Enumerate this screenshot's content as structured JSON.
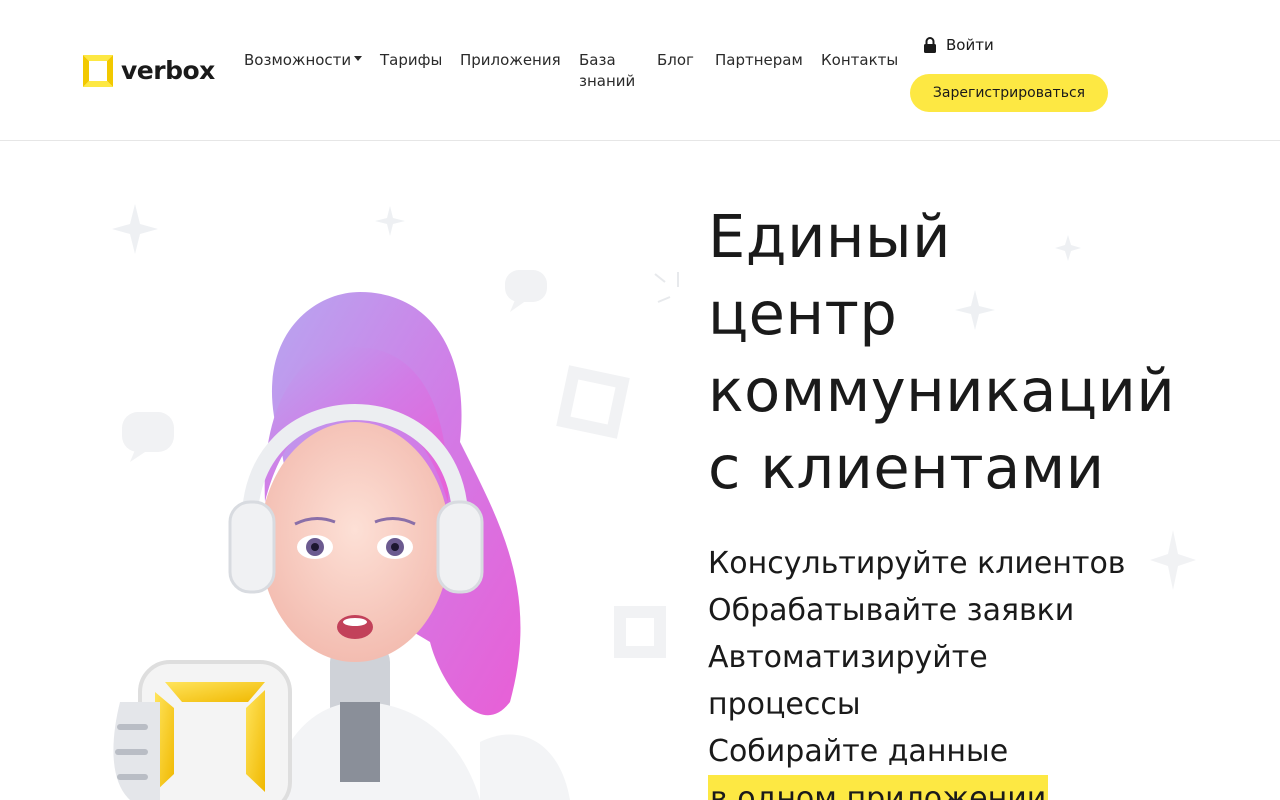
{
  "brand": {
    "name": "verbox",
    "accent": "#fde843",
    "text_color": "#1a1a1a"
  },
  "nav": {
    "items": [
      {
        "label": "Возможности",
        "dropdown": true
      },
      {
        "label": "Тарифы"
      },
      {
        "label": "Приложения"
      },
      {
        "label": "База знаний"
      },
      {
        "label": "Блог"
      },
      {
        "label": "Партнерам"
      },
      {
        "label": "Контакты"
      }
    ],
    "dropdown_icon": "caret-down-icon"
  },
  "account": {
    "login_label": "Войти",
    "login_icon": "lock-icon",
    "register_label": "Зарегистрироваться"
  },
  "hero": {
    "title_lines": [
      "Единый",
      "центр",
      "коммуникаций",
      "с клиентами"
    ],
    "benefits": [
      "Консультируйте клиентов",
      "Обрабатывайте заявки",
      "Автоматизируйте",
      "процессы",
      "Собирайте данные"
    ],
    "highlight": "в одном приложении",
    "illustration": "robot-assistant-with-headphones-illustration"
  }
}
